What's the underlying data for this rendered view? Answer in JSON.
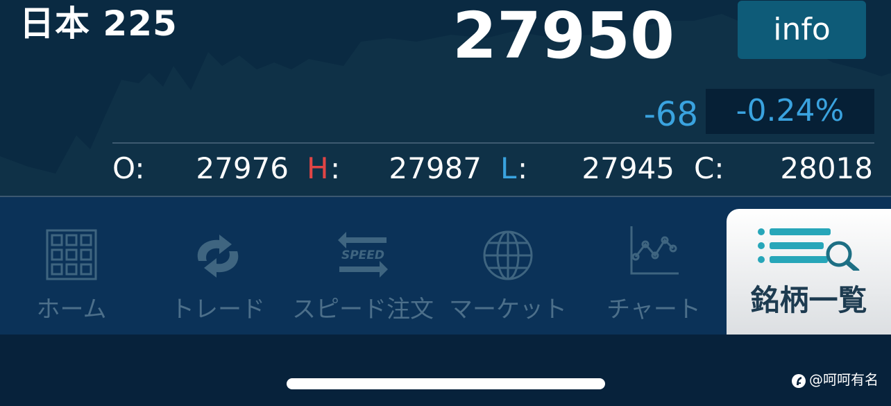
{
  "quote": {
    "instrument_name": "日本 225",
    "last_price": "27950",
    "info_label": "info",
    "change": "-68",
    "change_percent": "-0.24%",
    "colors": {
      "change": "#3aa3df",
      "high_label": "#e04545",
      "low_label": "#3aa3df"
    },
    "ohlc": {
      "open_label": "O:",
      "open_value": "27976",
      "high_label": "H",
      "high_colon": ":",
      "high_value": "27987",
      "low_label": "L",
      "low_colon": ":",
      "low_value": "27945",
      "close_label": "C:",
      "close_value": "28018"
    }
  },
  "tabs": [
    {
      "label": "ホーム",
      "icon": "grid-icon",
      "selected": false
    },
    {
      "label": "トレード",
      "icon": "refresh-arrows-icon",
      "selected": false
    },
    {
      "label": "スピード注文",
      "icon": "speed-arrows-icon",
      "icon_text": "SPEED",
      "selected": false
    },
    {
      "label": "マーケット",
      "icon": "globe-icon",
      "selected": false
    },
    {
      "label": "チャート",
      "icon": "line-chart-icon",
      "selected": false
    },
    {
      "label": "銘柄一覧",
      "icon": "list-search-icon",
      "selected": true
    }
  ],
  "watermark": {
    "text": "@呵呵有名"
  }
}
